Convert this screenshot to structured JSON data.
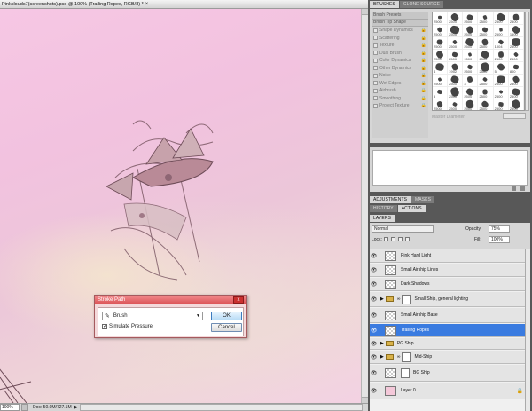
{
  "document": {
    "title": "Pinkclouds7(screenshots).psd @ 100% (Trailing Ropes, RGB/8) *",
    "close": "×",
    "zoom": "100%",
    "doc_info": "Doc: 50.0M/727.1M"
  },
  "dialog": {
    "title": "Stroke Path",
    "close": "x",
    "tool_label": "Brush",
    "simulate_pressure_label": "Simulate Pressure",
    "simulate_pressure_checked": true,
    "check_mark": "✓",
    "ok_label": "OK",
    "cancel_label": "Cancel"
  },
  "brushes_panel": {
    "tabs": [
      "BRUSHES",
      "CLONE SOURCE"
    ],
    "options": [
      "Brush Presets",
      "Brush Tip Shape",
      "Shape Dynamics",
      "Scattering",
      "Texture",
      "Dual Brush",
      "Color Dynamics",
      "Other Dynamics",
      "Noise",
      "Wet Edges",
      "Airbrush",
      "Smoothing",
      "Protect Texture"
    ],
    "lock_icon": "🔒",
    "sizes": [
      "2500",
      "2500",
      "2500",
      "2500",
      "2500",
      "2500",
      "2500",
      "2500",
      "2500",
      "2500",
      "2500",
      "1500",
      "2500",
      "2500",
      "2500",
      "2500",
      "1004",
      "2500",
      "2500",
      "2500",
      "1500",
      "2500",
      "2500",
      "2500",
      "4",
      "1952",
      "2500",
      "2500",
      "5",
      "800",
      "2500",
      "2500",
      "3",
      "2500",
      "2500",
      "2500",
      "5",
      "2500",
      "2500",
      "2500",
      "2500",
      "2500",
      "2500",
      "2500",
      "2500",
      "2500",
      "2500",
      "2500"
    ],
    "master_diameter_label": "Master Diameter"
  },
  "middle_tabs": [
    "ADJUSTMENTS",
    "MASKS"
  ],
  "history_tabs": [
    "HISTORY",
    "ACTIONS"
  ],
  "layers_panel": {
    "tabs": [
      "LAYERS"
    ],
    "blend_mode": "Normal",
    "opacity_label": "Opacity:",
    "opacity_value": "75%",
    "lock_label": "Lock:",
    "fill_label": "Fill:",
    "fill_value": "100%",
    "eye_icon": "👁",
    "lock_icon": "🔒",
    "tri_icon": "▶",
    "chain_icon": "∞",
    "layers": [
      {
        "name": "Pink Hard Light",
        "selected": false
      },
      {
        "name": "Small Airship Lines",
        "selected": false
      },
      {
        "name": "Dark Shadows",
        "selected": false
      },
      {
        "name": "Small Ship, general lighting",
        "selected": false
      },
      {
        "name": "Small Airship Base",
        "selected": false
      },
      {
        "name": "Trailing Ropes",
        "selected": true
      },
      {
        "name": "PG Ship",
        "selected": false
      },
      {
        "name": "Mid-Ship",
        "selected": false
      },
      {
        "name": "BG Ship",
        "selected": false
      },
      {
        "name": "Layer 0",
        "selected": false
      }
    ]
  }
}
